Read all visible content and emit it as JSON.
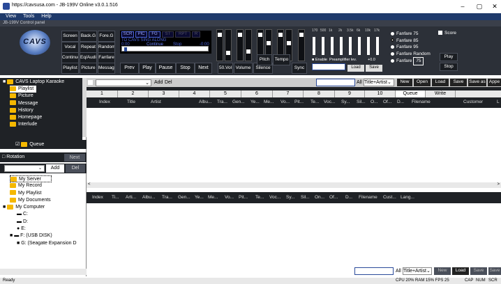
{
  "window": {
    "title": "https://cavsusa.com - JB-199V Online v3.0.1.516",
    "minimize": "–",
    "maximize": "▢",
    "close": "✕"
  },
  "menu": [
    "View",
    "Tools",
    "Help"
  ],
  "panel_label": "JB-199V Control panel",
  "logo_text": "CAVS",
  "grid_buttons": [
    [
      "Screen",
      "Back.G",
      "Fore.G"
    ],
    [
      "Vocal",
      "Repeat",
      "Random"
    ],
    [
      "Continue",
      "Eq/Audio",
      "Fanfare"
    ],
    [
      "Playlist",
      "Picture",
      "Message"
    ]
  ],
  "modes": [
    "SCR",
    "PIC",
    "FG",
    "ST",
    "RPT",
    "R"
  ],
  "status_line": "TO CAVS SING ALONG",
  "time_start": "0:00",
  "continue_label": "Continue",
  "stop_label": "Stop",
  "time_end": "-0:00",
  "transport": [
    "Prev",
    "Play",
    "Pause",
    "Stop",
    "Next"
  ],
  "mixer": {
    "vol_label": "50.Vol",
    "volume_label": "Volume",
    "silence_label": "Silence",
    "pitch_label": "Pitch",
    "tempo_label": "Tempo",
    "sync_label": "Sync"
  },
  "eq": {
    "freqs": [
      "170",
      "500",
      "1k",
      "2k",
      "3.5k",
      "6k",
      "10k",
      "17k"
    ],
    "enable_label": "Enable",
    "preamp_label": "Preamplifier lev.",
    "preamp_value": "+0.0",
    "load_label": "Load",
    "save_label": "Save"
  },
  "fanfare": {
    "options": [
      "Fanfare 75",
      "Fanfare 85",
      "Fanfare 95",
      "Fanfare Random",
      "Fanfare"
    ],
    "selected_index": 1,
    "custom_value": "75",
    "score_label": "Score",
    "play_label": "Play",
    "stop_label": "Stop"
  },
  "sidebar": {
    "root": "CAVS Laptop Karaoke",
    "items": [
      "Playlist",
      "Picture",
      "Message",
      "History",
      "Homepage",
      "Interlude"
    ],
    "queue_label": "Queue",
    "rotation_label": "Rotation",
    "next_label": "Next",
    "add_label": "Add",
    "del_label": "Del",
    "tree": [
      "My Server",
      "My Record",
      "My Playlist",
      "My Documents",
      "My Computer",
      "C:",
      "D:",
      "E:",
      "F: (USB DISK)",
      "G: (Seagate Expansion D"
    ]
  },
  "playlist_toolbar": {
    "add_label": "Add",
    "del_label": "Del",
    "all_label": "All",
    "filter_value": "Title+Artist",
    "buttons": [
      "New",
      "Open",
      "Load",
      "Save",
      "Save as",
      "Appe"
    ]
  },
  "tabs": [
    "1",
    "2",
    "3",
    "4",
    "5",
    "6",
    "7",
    "8",
    "9",
    "10",
    "Queue",
    "Write"
  ],
  "columns1": [
    "Index",
    "Title",
    "Artist",
    "Albu...",
    "Tra...",
    "Gen...",
    "Ye...",
    "Me...",
    "Vo...",
    "Pit...",
    "Te...",
    "Voc...",
    "Sy...",
    "Sil...",
    "O...",
    "Of...",
    "D...",
    "Filename",
    "Customer",
    "L"
  ],
  "columns2": [
    "Index",
    "Ti...",
    "Arti...",
    "Albu...",
    "Tra...",
    "Gen...",
    "Ye...",
    "Me...",
    "Vo...",
    "Pit...",
    "Te...",
    "Voc...",
    "Sy...",
    "Sil...",
    "On...",
    "Of...",
    "D...",
    "Filename",
    "Cust...",
    "Lang..."
  ],
  "bottom_toolbar": {
    "all_label": "All",
    "filter_value": "Title+Artist",
    "buttons": [
      "New",
      "Load",
      "Save",
      "Save"
    ]
  },
  "statusbar": {
    "left": "Ready",
    "right": "CPU 20% RAM 15% FPS 25",
    "caps": "CAP",
    "num": "NUM",
    "scrl": "SCR"
  }
}
